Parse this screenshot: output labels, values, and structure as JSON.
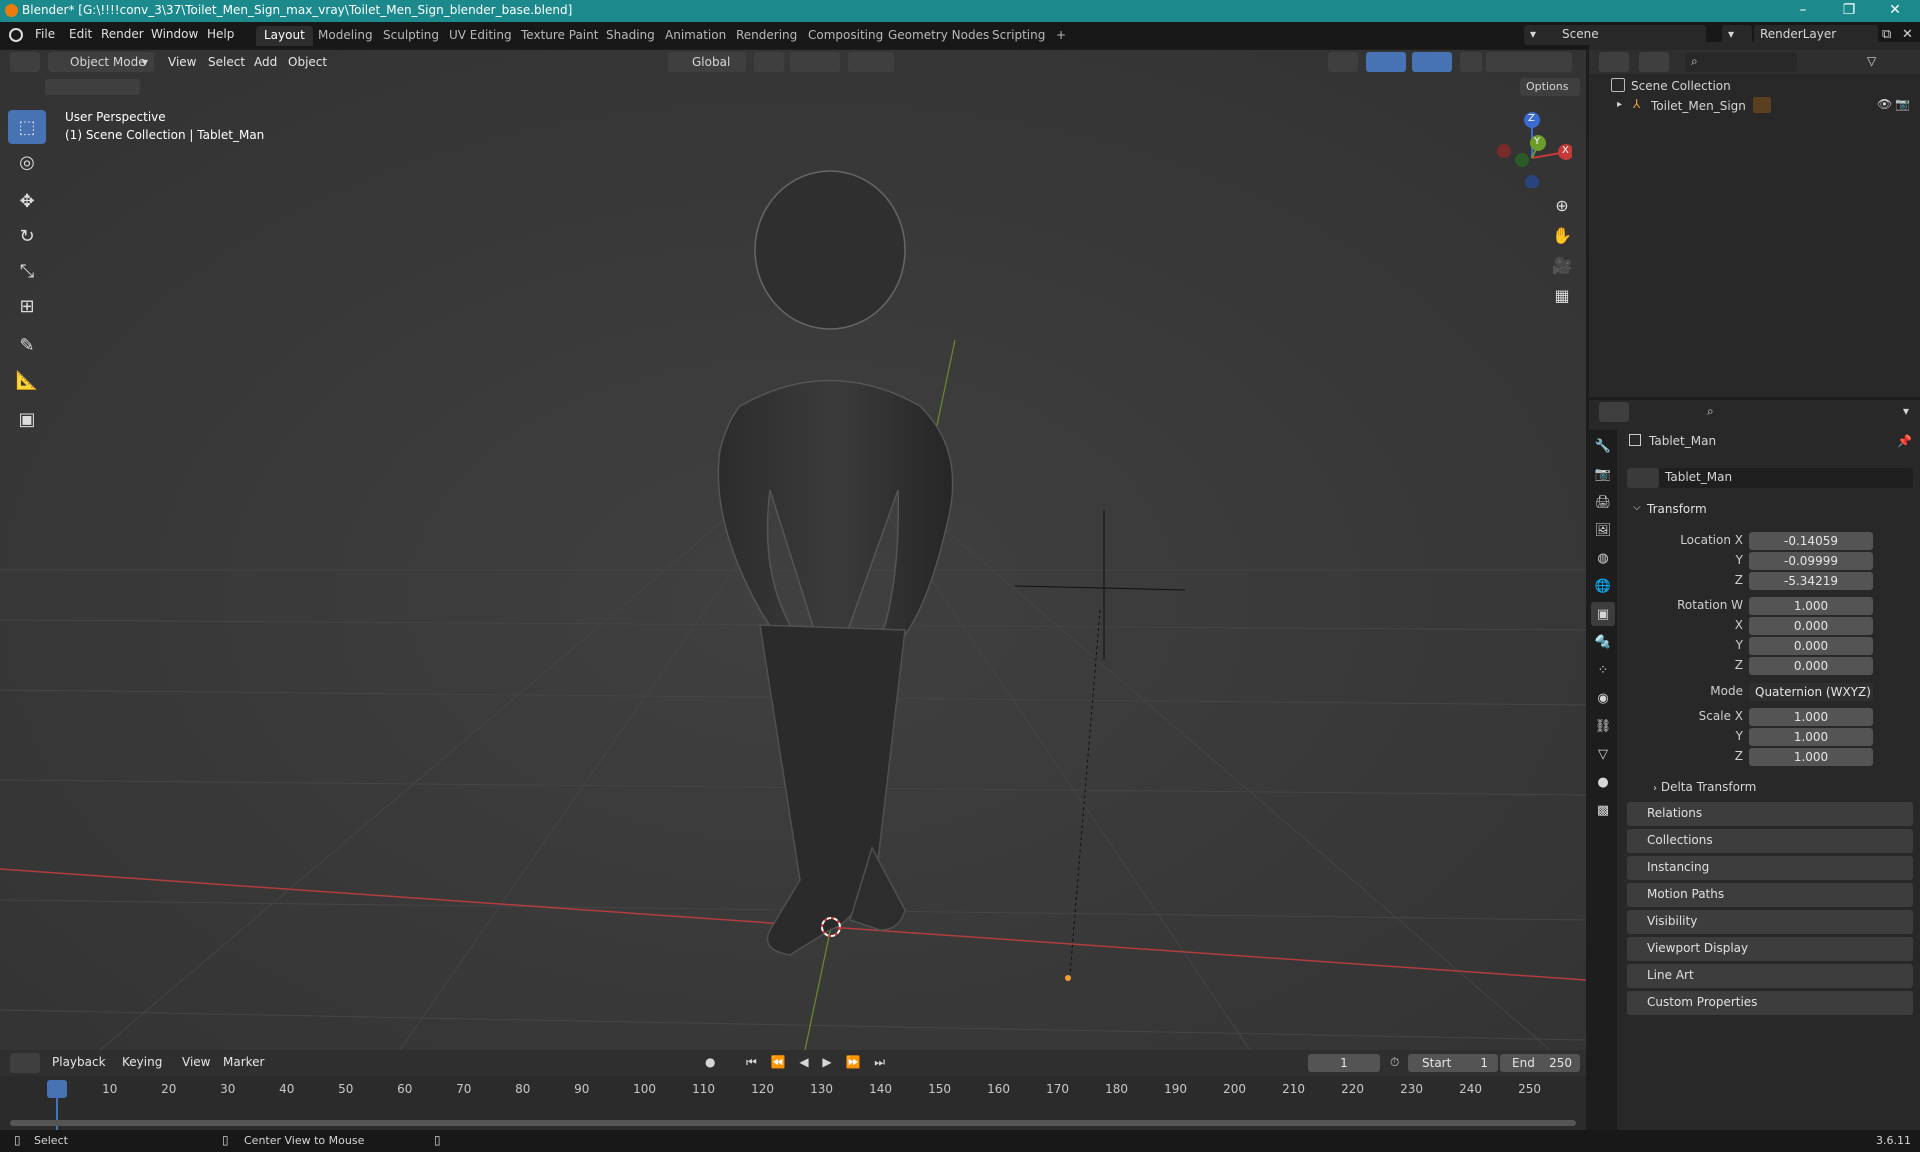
{
  "window": {
    "title": "Blender* [G:\\!!!!conv_3\\37\\Toilet_Men_Sign_max_vray\\Toilet_Men_Sign_blender_base.blend]",
    "minimize": "–",
    "maximize": "❐",
    "close": "✕"
  },
  "menus": [
    "File",
    "Edit",
    "Render",
    "Window",
    "Help"
  ],
  "workspaces": [
    "Layout",
    "Modeling",
    "Sculpting",
    "UV Editing",
    "Texture Paint",
    "Shading",
    "Animation",
    "Rendering",
    "Compositing",
    "Geometry Nodes",
    "Scripting",
    "+"
  ],
  "scene": {
    "name": "Scene",
    "layer": "RenderLayer"
  },
  "viewport": {
    "mode": "Object Mode",
    "menus": [
      "View",
      "Select",
      "Add",
      "Object"
    ],
    "orientation": "Global",
    "options": "Options",
    "perspective": "User Perspective",
    "collection_info": "(1) Scene Collection | Tablet_Man",
    "gizmo": {
      "z": "Z",
      "y": "Y",
      "x": "X"
    }
  },
  "outliner": {
    "root": "Scene Collection",
    "item": "Toilet_Men_Sign"
  },
  "properties": {
    "object_name": "Tablet_Man",
    "datablock": "Tablet_Man",
    "transform_label": "Transform",
    "location": {
      "label": "Location X",
      "x": "-0.14059",
      "y": "-0.09999",
      "z": "-5.34219"
    },
    "rotation": {
      "label": "Rotation W",
      "w": "1.000",
      "x": "0.000",
      "y": "0.000",
      "z": "0.000"
    },
    "mode": {
      "label": "Mode",
      "value": "Quaternion (WXYZ)"
    },
    "scale": {
      "label": "Scale X",
      "x": "1.000",
      "y": "1.000",
      "z": "1.000"
    },
    "axis_y": "Y",
    "axis_z": "Z",
    "axis_x": "X",
    "delta": "Delta Transform",
    "panels": [
      "Relations",
      "Collections",
      "Instancing",
      "Motion Paths",
      "Visibility",
      "Viewport Display",
      "Line Art",
      "Custom Properties"
    ]
  },
  "timeline": {
    "menus": [
      "Playback",
      "Keying",
      "View",
      "Marker"
    ],
    "current_frame": "1",
    "start_label": "Start",
    "start": "1",
    "end_label": "End",
    "end": "250",
    "ticks": [
      "1",
      "10",
      "20",
      "30",
      "40",
      "50",
      "60",
      "70",
      "80",
      "90",
      "100",
      "110",
      "120",
      "130",
      "140",
      "150",
      "160",
      "170",
      "180",
      "190",
      "200",
      "210",
      "220",
      "230",
      "240",
      "250"
    ]
  },
  "status": {
    "select": "Select",
    "center": "Center View to Mouse",
    "version": "3.6.11"
  }
}
